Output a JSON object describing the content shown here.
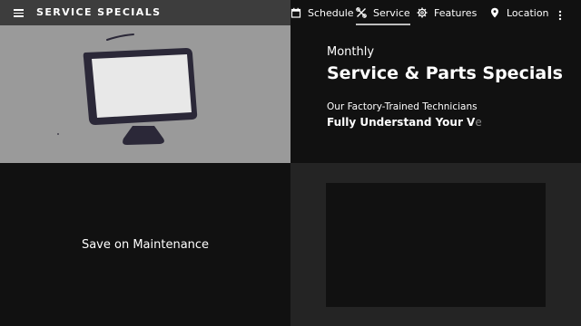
{
  "header": {
    "title": "SERVICE SPECIALS",
    "menu_icon": "hamburger-menu-icon",
    "more_icon": "more-vertical-icon"
  },
  "nav": {
    "items": [
      {
        "label": "Schedule",
        "icon": "calendar-icon",
        "active": false
      },
      {
        "label": "Service",
        "icon": "wrench-screwdriver-icon",
        "active": true
      },
      {
        "label": "Features",
        "icon": "gear-icon",
        "active": false
      },
      {
        "label": "Location",
        "icon": "map-pin-icon",
        "active": false
      }
    ]
  },
  "hero": {
    "image_icon": "computer-monitor-icon",
    "eyebrow": "Monthly",
    "heading": "Service & Parts Specials",
    "subheading": "Our Factory-Trained Technicians",
    "tagline_visible": "Fully Understand Your V",
    "tagline_faded": "e"
  },
  "promo": {
    "left_label": "Save on Maintenance"
  },
  "colors": {
    "header_left_bg": "#3d3d3d",
    "page_bg": "#111111",
    "hero_image_bg": "#9a9a9a",
    "monitor_body": "#2b2838",
    "monitor_screen": "#e8e8e8",
    "promo_right_bg": "#242424",
    "active_underline": "#bdbdbd"
  }
}
